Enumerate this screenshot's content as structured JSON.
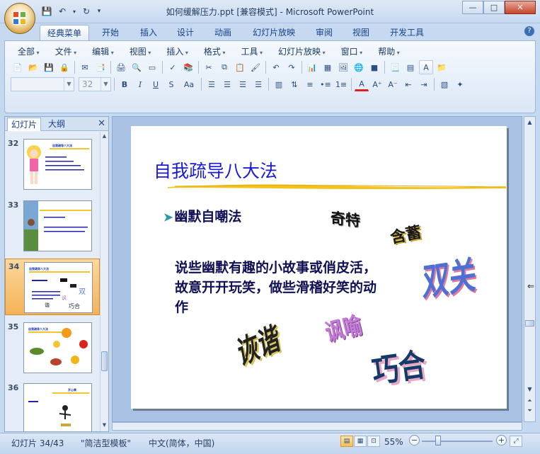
{
  "window": {
    "title": "如何缓解压力.ppt [兼容模式] - Microsoft PowerPoint",
    "controls": [
      "—",
      "□",
      "✕"
    ]
  },
  "ribbon": {
    "tabs": [
      "经典菜单",
      "开始",
      "插入",
      "设计",
      "动画",
      "幻灯片放映",
      "审阅",
      "视图",
      "开发工具"
    ],
    "menus": [
      "全部",
      "文件",
      "编辑",
      "视图",
      "插入",
      "格式",
      "工具",
      "幻灯片放映",
      "窗口",
      "帮助"
    ],
    "font_name": "",
    "font_size": "32",
    "format_buttons": [
      "B",
      "I",
      "U",
      "S",
      "Aa"
    ]
  },
  "left_pane": {
    "tab_slides": "幻灯片",
    "tab_outline": "大纲",
    "thumbnails": [
      {
        "num": "32",
        "title": "自我疏导八大法"
      },
      {
        "num": "33",
        "title": ""
      },
      {
        "num": "34",
        "title": "自我疏导八大法"
      },
      {
        "num": "35",
        "title": "自我疏导八大法"
      },
      {
        "num": "36",
        "title": "开心果"
      }
    ]
  },
  "slide": {
    "title": "自我疏导八大法",
    "bullet": "幽默自嘲法",
    "body": "说些幽默有趣的小故事或俏皮活，故意开开玩笑，做些滑稽好笑的动作",
    "words": [
      "奇特",
      "含蓄",
      "双关",
      "诙谐",
      "讽喻",
      "巧合"
    ]
  },
  "status": {
    "slide_indicator": "幻灯片 34/43",
    "template": "\"简洁型模板\"",
    "language": "中文(简体，中国)",
    "zoom": "55%"
  }
}
